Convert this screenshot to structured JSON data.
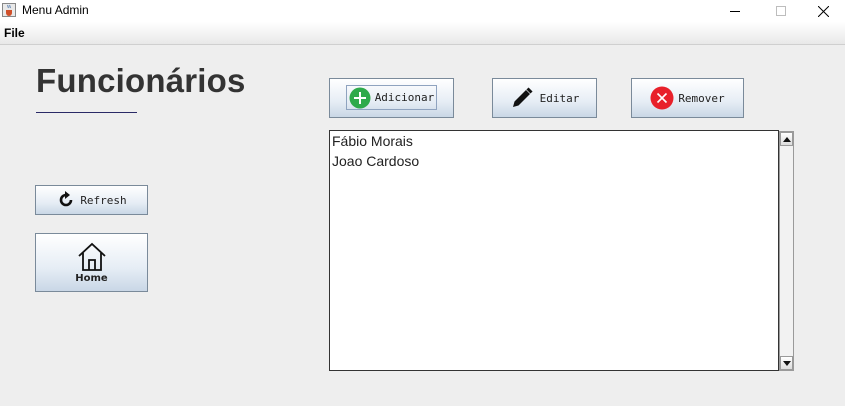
{
  "window": {
    "title": "Menu Admin",
    "icon": "java-cup-icon"
  },
  "menubar": {
    "file": "File"
  },
  "page": {
    "title": "Funcionários"
  },
  "sidebar": {
    "refresh": "Refresh",
    "home": "Home"
  },
  "toolbar": {
    "add": "Adicionar",
    "edit": "Editar",
    "remove": "Remover"
  },
  "list": {
    "items": [
      "Fábio Morais",
      "Joao Cardoso"
    ]
  },
  "colors": {
    "add_icon": "#2eaa4a",
    "remove_icon": "#e8202a",
    "button_border": "#7a8a9a"
  }
}
